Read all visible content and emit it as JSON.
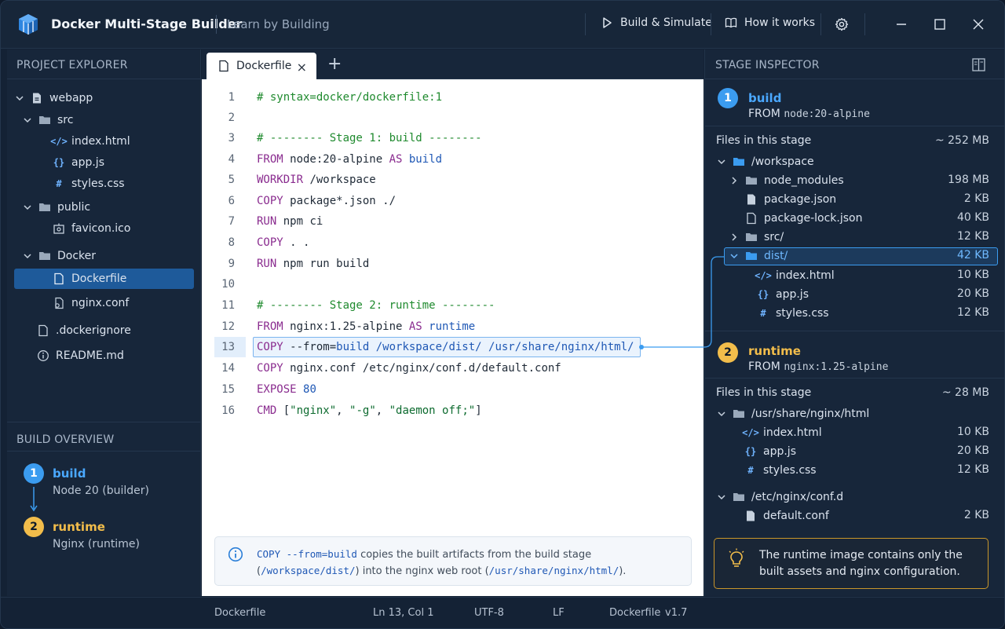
{
  "window": {
    "app_title": "Docker Multi-Stage Builder",
    "subtitle": "Learn by Building",
    "toolbar": {
      "build_label": "Build & Simulate",
      "how_label": "How it works"
    }
  },
  "explorer": {
    "header": "PROJECT EXPLORER",
    "items": [
      {
        "label": "webapp"
      },
      {
        "label": "src"
      },
      {
        "label": "index.html"
      },
      {
        "label": "app.js"
      },
      {
        "label": "styles.css"
      },
      {
        "label": "public"
      },
      {
        "label": "favicon.ico"
      },
      {
        "label": "Docker"
      },
      {
        "label": "Dockerfile"
      },
      {
        "label": "nginx.conf"
      },
      {
        "label": ".dockerignore"
      },
      {
        "label": "README.md"
      }
    ]
  },
  "build_overview": {
    "header": "BUILD OVERVIEW",
    "stages": [
      {
        "num": "1",
        "name": "build",
        "desc": "Node 20 (builder)"
      },
      {
        "num": "2",
        "name": "runtime",
        "desc": "Nginx (runtime)"
      }
    ]
  },
  "editor": {
    "tab_label": "Dockerfile",
    "close": "×",
    "add": "+",
    "lines": [
      {
        "n": "1"
      },
      {
        "n": "2"
      },
      {
        "n": "3"
      },
      {
        "n": "4"
      },
      {
        "n": "5"
      },
      {
        "n": "6"
      },
      {
        "n": "7"
      },
      {
        "n": "8"
      },
      {
        "n": "9"
      },
      {
        "n": "10"
      },
      {
        "n": "11"
      },
      {
        "n": "12"
      },
      {
        "n": "13"
      },
      {
        "n": "14"
      },
      {
        "n": "15"
      },
      {
        "n": "16"
      }
    ],
    "code": {
      "l1": "# syntax=docker/dockerfile:1",
      "l3": "# -------- Stage 1: build --------",
      "l4_kw": "FROM",
      "l4_a": " node:20-alpine ",
      "l4_as": "AS",
      "l4_b": "build",
      "l5_kw": "WORKDIR",
      "l5_a": " /workspace",
      "l6_kw": "COPY",
      "l6_a": " package*.json ./",
      "l7_kw": "RUN",
      "l7_a": " npm ci",
      "l8_kw": "COPY",
      "l8_a": " . .",
      "l9_kw": "RUN",
      "l9_a": " npm run build",
      "l11": "# -------- Stage 2: runtime --------",
      "l12_kw": "FROM",
      "l12_a": " nginx:1.25-alpine ",
      "l12_as": "AS",
      "l12_b": "runtime",
      "l13_kw": "COPY",
      "l13_a": " --from=",
      "l13_b": "build /workspace/dist/ /usr/share/nginx/html/",
      "l14_kw": "COPY",
      "l14_a": " nginx.conf /etc/nginx/conf.d/default.conf",
      "l15_kw": "EXPOSE",
      "l15_a": "80",
      "l16_kw": "CMD",
      "l16_a": " [",
      "l16_s1": "\"nginx\"",
      "l16_c1": ", ",
      "l16_s2": "\"-g\"",
      "l16_c2": ", ",
      "l16_s3": "\"daemon off;\"",
      "l16_e": "]"
    },
    "info": {
      "code1": "COPY --from=build",
      "text1": " copies the built artifacts from the build stage",
      "p1": "(",
      "code2": "/workspace/dist/",
      "text2": ") into the nginx web root (",
      "code3": "/usr/share/nginx/html/",
      "text3": ")."
    }
  },
  "inspector": {
    "header": "STAGE INSPECTOR",
    "stage1": {
      "num": "1",
      "name": "build",
      "from_kw": "FROM",
      "from_val": "node:20-alpine",
      "files_label": "Files in this stage",
      "total": "~ 252 MB",
      "files": [
        {
          "name": "/workspace",
          "size": ""
        },
        {
          "name": "node_modules",
          "size": "198 MB"
        },
        {
          "name": "package.json",
          "size": "2 KB"
        },
        {
          "name": "package-lock.json",
          "size": "40 KB"
        },
        {
          "name": "src/",
          "size": "12 KB"
        },
        {
          "name": "dist/",
          "size": "42 KB"
        },
        {
          "name": "index.html",
          "size": "10 KB"
        },
        {
          "name": "app.js",
          "size": "20 KB"
        },
        {
          "name": "styles.css",
          "size": "12 KB"
        }
      ]
    },
    "stage2": {
      "num": "2",
      "name": "runtime",
      "from_kw": "FROM",
      "from_val": "nginx:1.25-alpine",
      "files_label": "Files in this stage",
      "total": "~ 28 MB",
      "files": [
        {
          "name": "/usr/share/nginx/html",
          "size": ""
        },
        {
          "name": "index.html",
          "size": "10 KB"
        },
        {
          "name": "app.js",
          "size": "20 KB"
        },
        {
          "name": "styles.css",
          "size": "12 KB"
        },
        {
          "name": "/etc/nginx/conf.d",
          "size": ""
        },
        {
          "name": "default.conf",
          "size": "2 KB"
        }
      ]
    },
    "note": "The runtime image contains only the built assets and nginx configuration."
  },
  "statusbar": {
    "file": "Dockerfile",
    "position": "Ln 13, Col 1",
    "encoding": "UTF-8",
    "eol": "LF",
    "language": "Dockerfile",
    "version": "v1.7"
  },
  "colors": {
    "accent_blue": "#3b9cf0",
    "accent_yellow": "#f2bd4b",
    "selection": "#1e5a9a"
  }
}
